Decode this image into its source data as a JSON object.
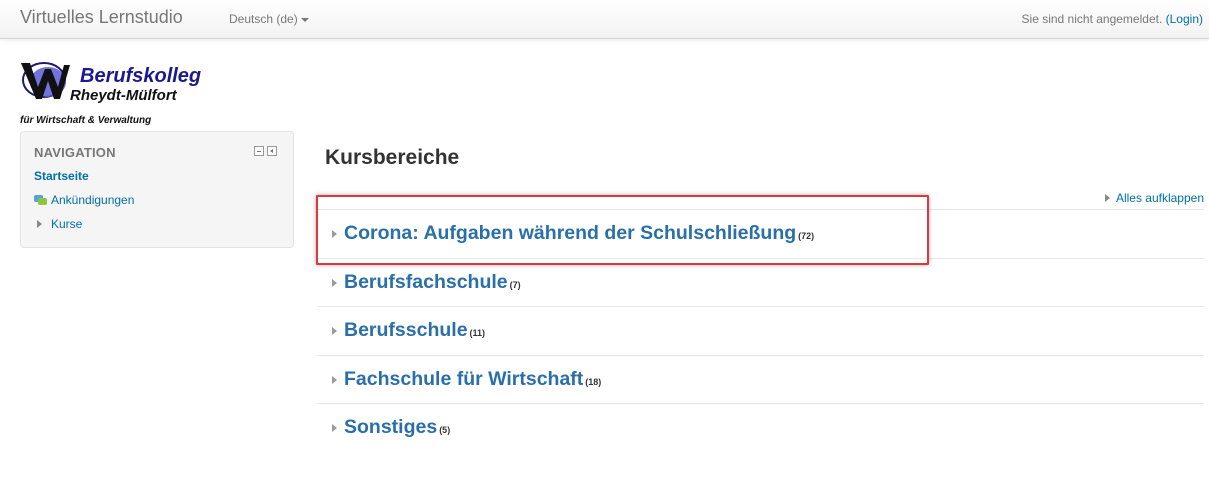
{
  "navbar": {
    "brand": "Virtuelles Lernstudio",
    "language": "Deutsch (de)",
    "login_status": "Sie sind nicht angemeldet.",
    "login_link": "(Login)"
  },
  "logo": {
    "line1": "Berufskolleg",
    "line2": "Rheydt-Mülfort",
    "line3": "für Wirtschaft & Verwaltung"
  },
  "navigation": {
    "title": "NAVIGATION",
    "home": "Startseite",
    "items": [
      {
        "label": "Ankündigungen",
        "icon": "forum-icon"
      },
      {
        "label": "Kurse",
        "icon": "expand-arrow-icon"
      }
    ]
  },
  "main": {
    "title": "Kursbereiche",
    "expand_all": "Alles aufklappen",
    "categories": [
      {
        "name": "Corona: Aufgaben während der Schulschließung",
        "count": "(72)"
      },
      {
        "name": "Berufsfachschule",
        "count": "(7)"
      },
      {
        "name": "Berufsschule",
        "count": "(11)"
      },
      {
        "name": "Fachschule für Wirtschaft",
        "count": "(18)"
      },
      {
        "name": "Sonstiges",
        "count": "(5)"
      }
    ]
  },
  "colors": {
    "link": "#0070a8",
    "category": "#2a6faa",
    "highlight": "#d93a3f"
  }
}
